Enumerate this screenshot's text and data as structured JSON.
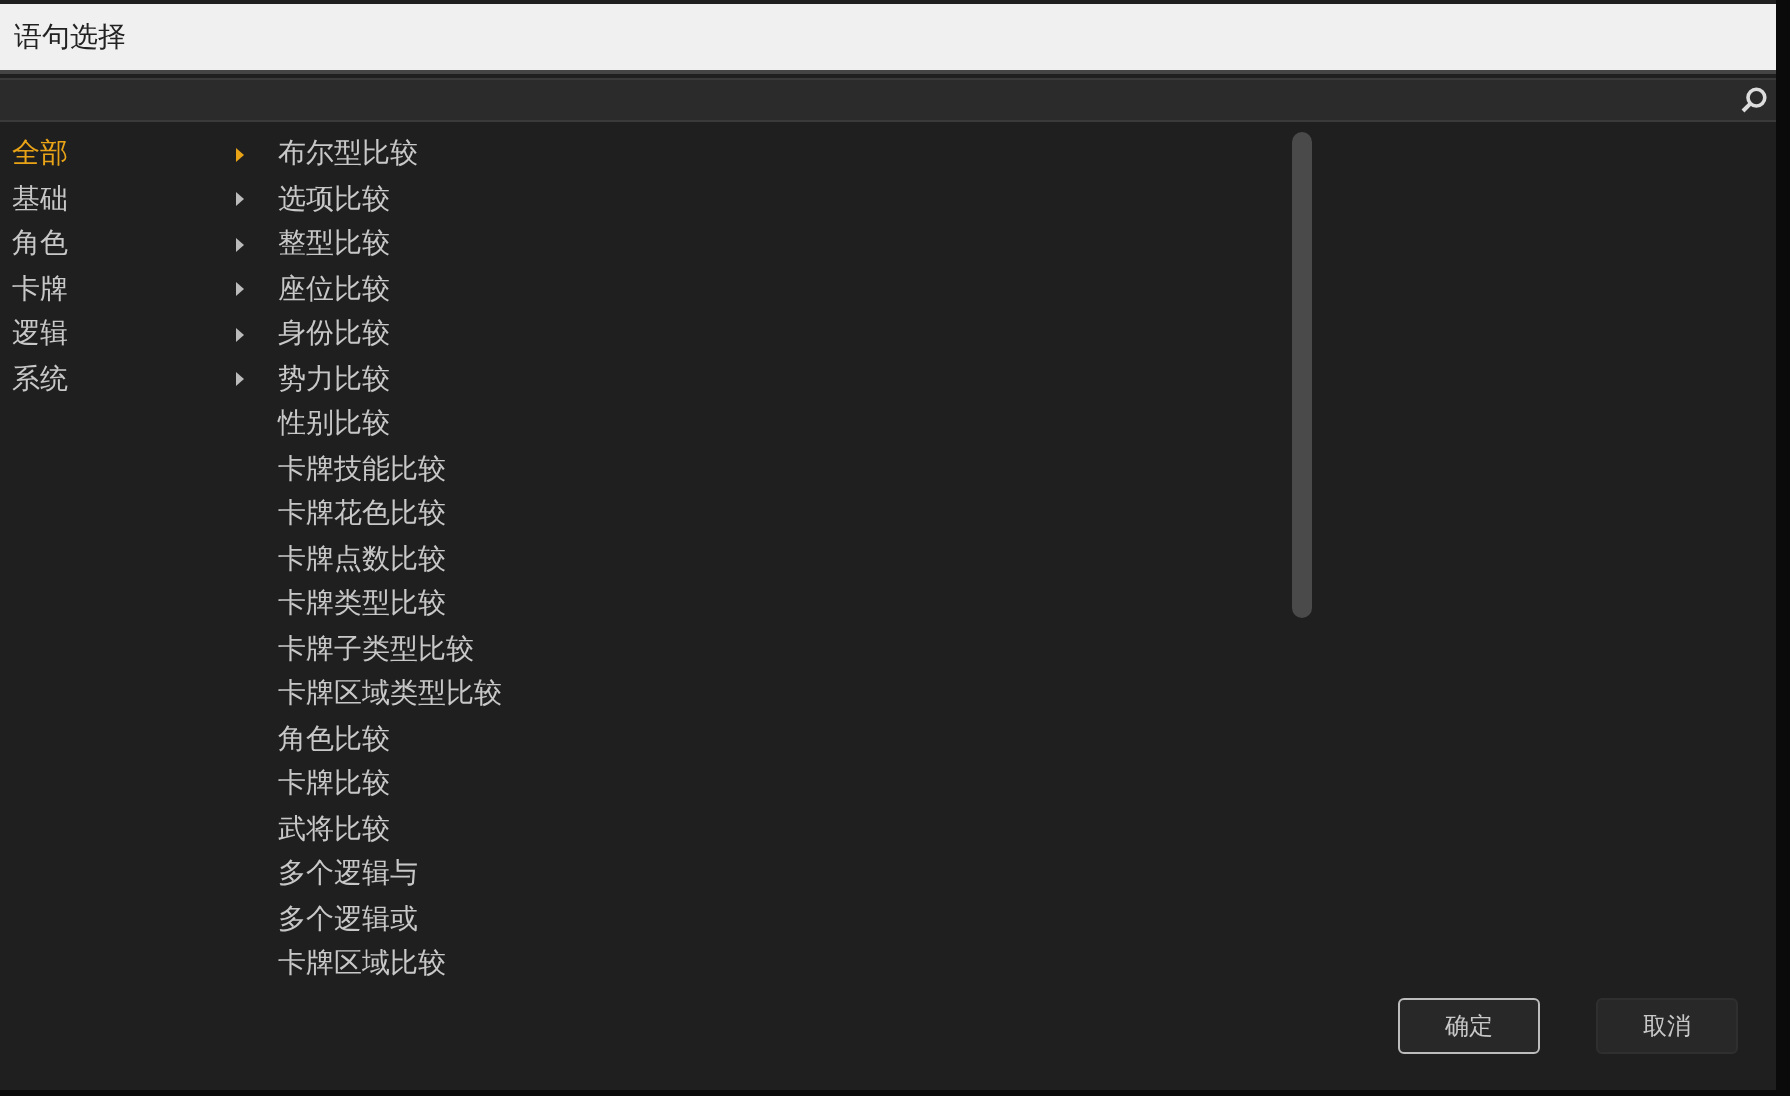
{
  "window": {
    "title": "语句选择"
  },
  "categories": [
    {
      "label": "全部",
      "selected": true
    },
    {
      "label": "基础",
      "selected": false
    },
    {
      "label": "角色",
      "selected": false
    },
    {
      "label": "卡牌",
      "selected": false
    },
    {
      "label": "逻辑",
      "selected": false
    },
    {
      "label": "系统",
      "selected": false
    }
  ],
  "items": [
    "布尔型比较",
    "选项比较",
    "整型比较",
    "座位比较",
    "身份比较",
    "势力比较",
    "性别比较",
    "卡牌技能比较",
    "卡牌花色比较",
    "卡牌点数比较",
    "卡牌类型比较",
    "卡牌子类型比较",
    "卡牌区域类型比较",
    "角色比较",
    "卡牌比较",
    "武将比较",
    "多个逻辑与",
    "多个逻辑或",
    "卡牌区域比较"
  ],
  "buttons": [
    {
      "label": "确定",
      "kind": "primary"
    },
    {
      "label": "取消",
      "kind": "secondary"
    }
  ]
}
